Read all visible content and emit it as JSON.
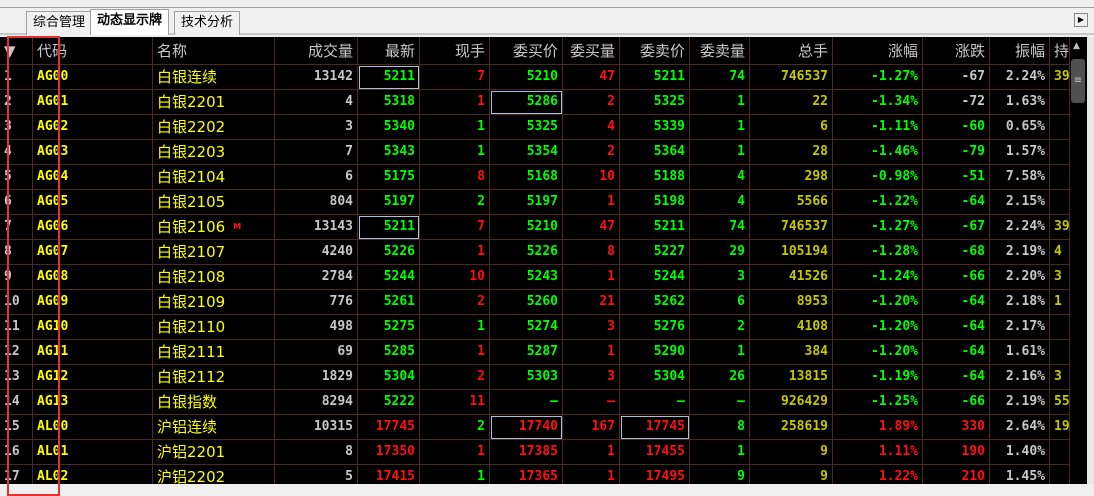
{
  "tabs": [
    "综合管理",
    "动态显示牌",
    "技术分析"
  ],
  "active_tab": 1,
  "columns": [
    {
      "label": "▼",
      "w": 33,
      "a": "l"
    },
    {
      "label": "代码",
      "w": 120,
      "a": "l"
    },
    {
      "label": "名称",
      "w": 122,
      "a": "l"
    },
    {
      "label": "成交量",
      "w": 83,
      "a": "r"
    },
    {
      "label": "最新",
      "w": 62,
      "a": "r"
    },
    {
      "label": "现手",
      "w": 70,
      "a": "r"
    },
    {
      "label": "委买价",
      "w": 73,
      "a": "r"
    },
    {
      "label": "委买量",
      "w": 57,
      "a": "r"
    },
    {
      "label": "委卖价",
      "w": 70,
      "a": "r"
    },
    {
      "label": "委卖量",
      "w": 60,
      "a": "r"
    },
    {
      "label": "总手",
      "w": 83,
      "a": "r"
    },
    {
      "label": "涨幅",
      "w": 90,
      "a": "r"
    },
    {
      "label": "涨跌",
      "w": 67,
      "a": "r"
    },
    {
      "label": "振幅",
      "w": 60,
      "a": "r"
    },
    {
      "label": "持",
      "w": 20,
      "a": "l"
    }
  ],
  "rows": [
    {
      "c": [
        "1",
        "AG00",
        "白银连续",
        "13142",
        "5211",
        "7",
        "5210",
        "47",
        "5211",
        "74",
        "746537",
        "-1.27%",
        "-67",
        "2.24%",
        "39"
      ],
      "k": "wyywgrgrggogwwo",
      "box": [
        4
      ]
    },
    {
      "c": [
        "2",
        "AG01",
        "白银2201",
        "4",
        "5318",
        "1",
        "5286",
        "2",
        "5325",
        "1",
        "22",
        "-1.34%",
        "-72",
        "1.63%",
        ""
      ],
      "k": "wyywgrgrggogwwo",
      "box": [
        6
      ]
    },
    {
      "c": [
        "3",
        "AG02",
        "白银2202",
        "3",
        "5340",
        "1",
        "5325",
        "4",
        "5339",
        "1",
        "6",
        "-1.11%",
        "-60",
        "0.65%",
        ""
      ],
      "k": "wyywgggrggoggwo"
    },
    {
      "c": [
        "4",
        "AG03",
        "白银2203",
        "7",
        "5343",
        "1",
        "5354",
        "2",
        "5364",
        "1",
        "28",
        "-1.46%",
        "-79",
        "1.57%",
        ""
      ],
      "k": "wyywgggrggoggwo"
    },
    {
      "c": [
        "5",
        "AG04",
        "白银2104",
        "6",
        "5175",
        "8",
        "5168",
        "10",
        "5188",
        "4",
        "298",
        "-0.98%",
        "-51",
        "7.58%",
        ""
      ],
      "k": "wyywgrgrggoggwo"
    },
    {
      "c": [
        "6",
        "AG05",
        "白银2105",
        "804",
        "5197",
        "2",
        "5197",
        "1",
        "5198",
        "4",
        "5566",
        "-1.22%",
        "-64",
        "2.15%",
        ""
      ],
      "k": "wyywgggrggoggwo"
    },
    {
      "c": [
        "7",
        "AG06",
        "白银2106",
        "13143",
        "5211",
        "7",
        "5210",
        "47",
        "5211",
        "74",
        "746537",
        "-1.27%",
        "-67",
        "2.24%",
        "39"
      ],
      "k": "wyywgrgrggoggwo",
      "box": [
        4
      ],
      "mark": "M"
    },
    {
      "c": [
        "8",
        "AG07",
        "白银2107",
        "4240",
        "5226",
        "1",
        "5226",
        "8",
        "5227",
        "29",
        "105194",
        "-1.28%",
        "-68",
        "2.19%",
        "4"
      ],
      "k": "wyywgrgrggoggwo"
    },
    {
      "c": [
        "9",
        "AG08",
        "白银2108",
        "2784",
        "5244",
        "10",
        "5243",
        "1",
        "5244",
        "3",
        "41526",
        "-1.24%",
        "-66",
        "2.20%",
        "3"
      ],
      "k": "wyywgrgrggoggwo"
    },
    {
      "c": [
        "10",
        "AG09",
        "白银2109",
        "776",
        "5261",
        "2",
        "5260",
        "21",
        "5262",
        "6",
        "8953",
        "-1.20%",
        "-64",
        "2.18%",
        "1"
      ],
      "k": "wyywgrgrggoggwo"
    },
    {
      "c": [
        "11",
        "AG10",
        "白银2110",
        "498",
        "5275",
        "1",
        "5274",
        "3",
        "5276",
        "2",
        "4108",
        "-1.20%",
        "-64",
        "2.17%",
        ""
      ],
      "k": "wyywgggrggoggwo"
    },
    {
      "c": [
        "12",
        "AG11",
        "白银2111",
        "69",
        "5285",
        "1",
        "5287",
        "1",
        "5290",
        "1",
        "384",
        "-1.20%",
        "-64",
        "1.61%",
        ""
      ],
      "k": "wyywgrgrggoggwo"
    },
    {
      "c": [
        "13",
        "AG12",
        "白银2112",
        "1829",
        "5304",
        "2",
        "5303",
        "3",
        "5304",
        "26",
        "13815",
        "-1.19%",
        "-64",
        "2.16%",
        "3"
      ],
      "k": "wyywgrgrggoggwo"
    },
    {
      "c": [
        "14",
        "AG13",
        "白银指数",
        "8294",
        "5222",
        "11",
        "—",
        "—",
        "—",
        "—",
        "926429",
        "-1.25%",
        "-66",
        "2.19%",
        "55"
      ],
      "k": "wyywgrgrggoggwo"
    },
    {
      "c": [
        "15",
        "AL00",
        "沪铝连续",
        "10315",
        "17745",
        "2",
        "17740",
        "167",
        "17745",
        "8",
        "258619",
        "1.89%",
        "330",
        "2.64%",
        "19"
      ],
      "k": "wyywrgrrrgorrwo",
      "box": [
        6,
        8
      ]
    },
    {
      "c": [
        "16",
        "AL01",
        "沪铝2201",
        "8",
        "17350",
        "1",
        "17385",
        "1",
        "17455",
        "1",
        "9",
        "1.11%",
        "190",
        "1.40%",
        ""
      ],
      "k": "wyywrrrrrgorrwo"
    },
    {
      "c": [
        "17",
        "AL02",
        "沪铝2202",
        "5",
        "17415",
        "1",
        "17365",
        "1",
        "17495",
        "9",
        "9",
        "1.22%",
        "210",
        "1.45%",
        ""
      ],
      "k": "wyywrgrrrgorrwo"
    }
  ]
}
